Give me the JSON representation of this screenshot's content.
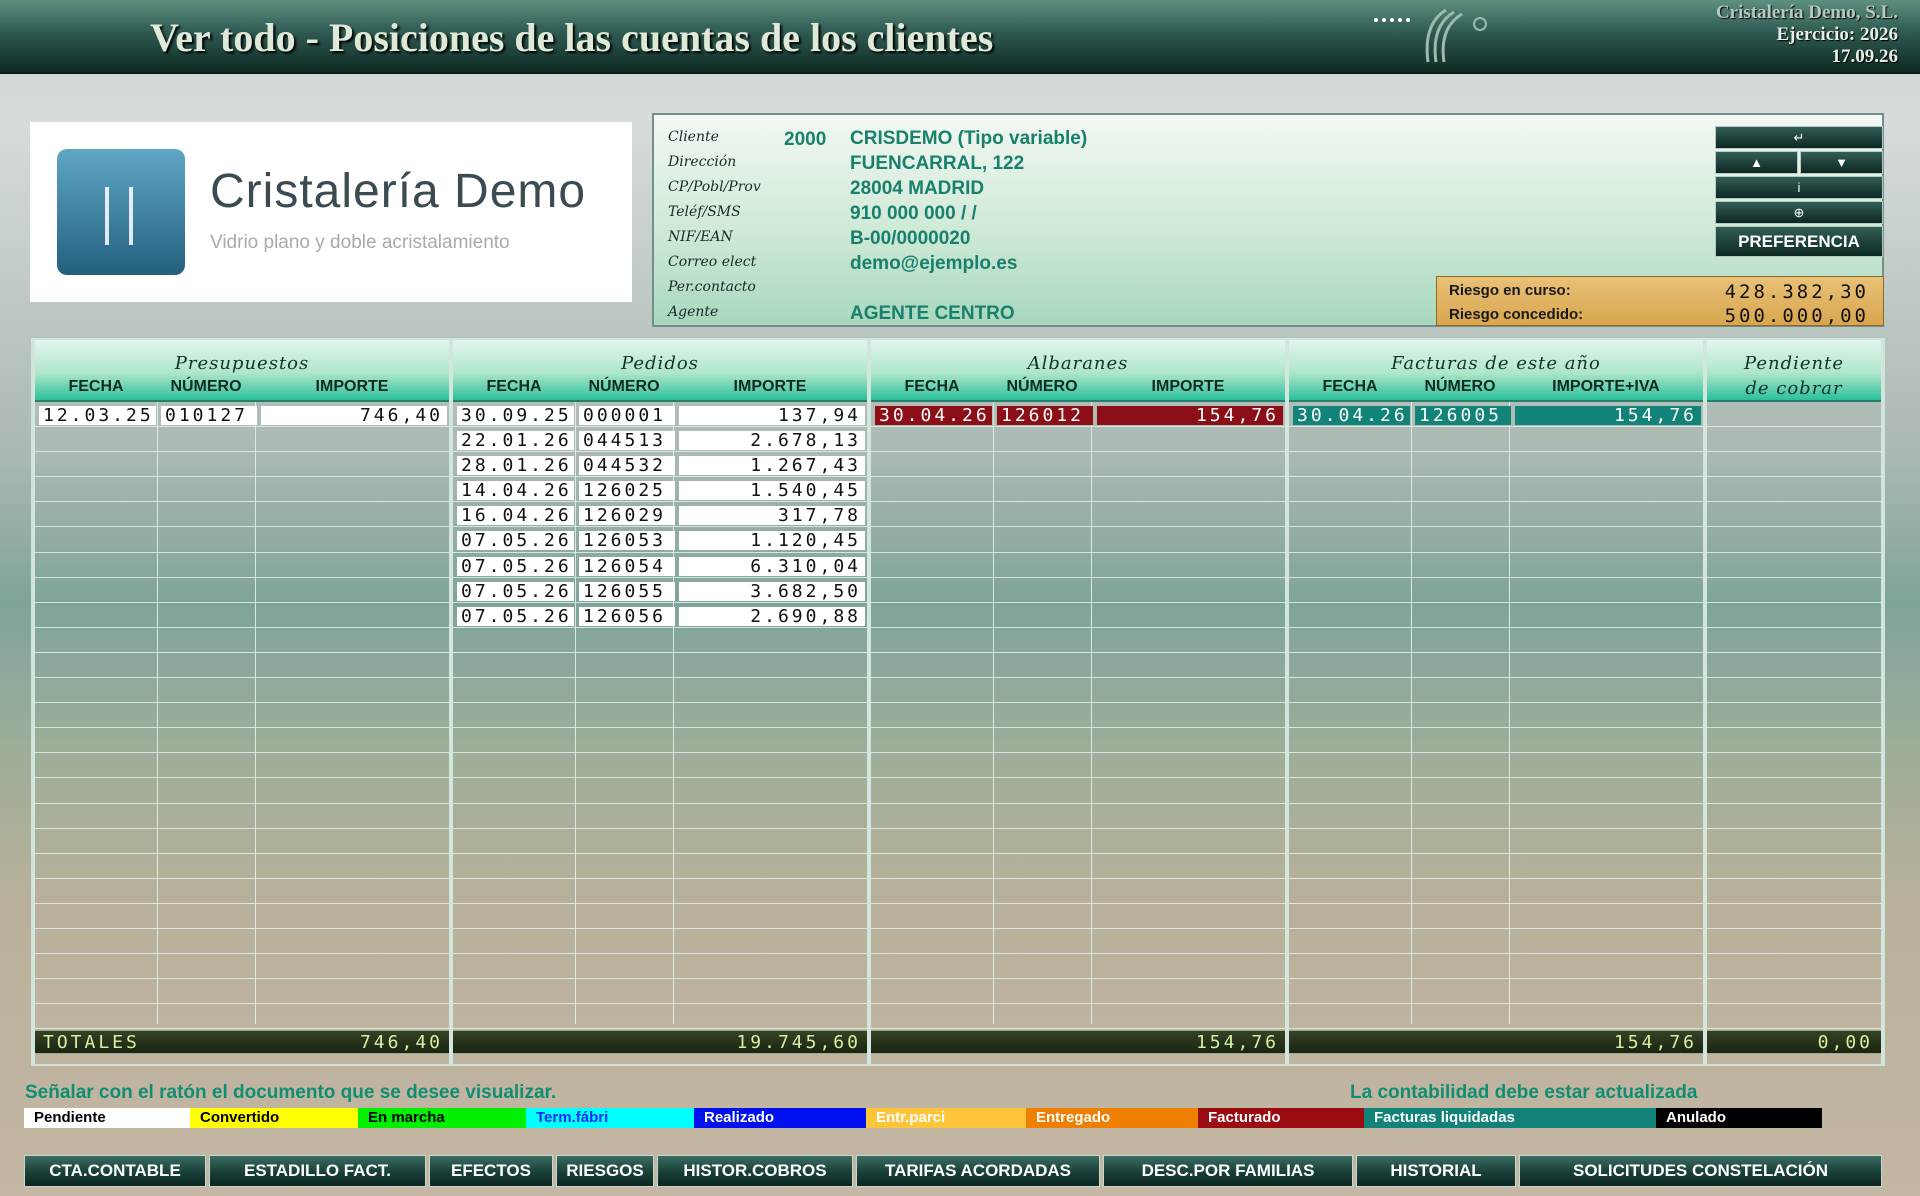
{
  "header": {
    "title": "Ver todo - Posiciones de las cuentas de los clientes",
    "company": "Cristalería Demo, S.L.",
    "ejercicio": "Ejercicio: 2026",
    "date": "17.09.26"
  },
  "logo": {
    "name": "Cristalería Demo",
    "tagline": "Vidrio plano y doble acristalamiento"
  },
  "client": {
    "labels": {
      "cliente": "Cliente",
      "direccion": "Dirección",
      "cp": "CP/Pobl/Prov",
      "telef": "Teléf/SMS",
      "nif": "NIF/EAN",
      "correo": "Correo elect",
      "percontacto": "Per.contacto",
      "agente": "Agente"
    },
    "code": "2000",
    "name": "CRISDEMO (Tipo variable)",
    "address": "FUENCARRAL, 122",
    "cp": "28004 MADRID",
    "phone": "910 000 000 /  /",
    "nif": "B-00/0000020",
    "email": "demo@ejemplo.es",
    "contact": "",
    "agent": "AGENTE CENTRO"
  },
  "nav": {
    "enter": "↵",
    "up": "▲",
    "down": "▼",
    "info": "i",
    "globe": "⊕",
    "preferencia": "PREFERENCIA"
  },
  "riesgo": {
    "curso_label": "Riesgo en curso:",
    "curso_value": "428.382,30",
    "concedido_label": "Riesgo concedido:",
    "concedido_value": "500.000,00"
  },
  "columns": {
    "fecha": "FECHA",
    "numero": "NÚMERO",
    "importe": "IMPORTE",
    "importe_iva": "IMPORTE+IVA"
  },
  "sections": {
    "presupuestos": {
      "title": "Presupuestos",
      "rows": [
        {
          "fecha": "12.03.25",
          "numero": "010127",
          "importe": "746,40",
          "status": "pendiente"
        }
      ],
      "total": "746,40",
      "total_label": "TOTALES"
    },
    "pedidos": {
      "title": "Pedidos",
      "rows": [
        {
          "fecha": "30.09.25",
          "numero": "000001",
          "importe": "137,94",
          "status": "pendiente"
        },
        {
          "fecha": "22.01.26",
          "numero": "044513",
          "importe": "2.678,13",
          "status": "pendiente"
        },
        {
          "fecha": "28.01.26",
          "numero": "044532",
          "importe": "1.267,43",
          "status": "pendiente"
        },
        {
          "fecha": "14.04.26",
          "numero": "126025",
          "importe": "1.540,45",
          "status": "pendiente"
        },
        {
          "fecha": "16.04.26",
          "numero": "126029",
          "importe": "317,78",
          "status": "pendiente"
        },
        {
          "fecha": "07.05.26",
          "numero": "126053",
          "importe": "1.120,45",
          "status": "pendiente"
        },
        {
          "fecha": "07.05.26",
          "numero": "126054",
          "importe": "6.310,04",
          "status": "pendiente"
        },
        {
          "fecha": "07.05.26",
          "numero": "126055",
          "importe": "3.682,50",
          "status": "pendiente"
        },
        {
          "fecha": "07.05.26",
          "numero": "126056",
          "importe": "2.690,88",
          "status": "pendiente"
        }
      ],
      "total": "19.745,60"
    },
    "albaranes": {
      "title": "Albaranes",
      "rows": [
        {
          "fecha": "30.04.26",
          "numero": "126012",
          "importe": "154,76",
          "status": "facturado"
        }
      ],
      "total": "154,76"
    },
    "facturas": {
      "title": "Facturas de este año",
      "rows": [
        {
          "fecha": "30.04.26",
          "numero": "126005",
          "importe": "154,76",
          "status": "liquidada"
        }
      ],
      "total": "154,76"
    },
    "pendiente": {
      "title_line1": "Pendiente",
      "title_line2": "de cobrar",
      "total": "0,00"
    }
  },
  "hint": "Señalar con el ratón el documento que se desee visualizar.",
  "hint2": "La contabilidad debe estar actualizada",
  "legend": [
    {
      "label": "Pendiente",
      "bg": "#ffffff",
      "fg": "#000000"
    },
    {
      "label": "Convertido",
      "bg": "#ffff00",
      "fg": "#000000"
    },
    {
      "label": "En marcha",
      "bg": "#00ee00",
      "fg": "#000000"
    },
    {
      "label": "Term.fábri",
      "bg": "#00ffff",
      "fg": "#1a2cff"
    },
    {
      "label": "Realizado",
      "bg": "#0010ee",
      "fg": "#ffffff"
    },
    {
      "label": "Entr.parci",
      "bg": "#ffc53a",
      "fg": "#ffffff"
    },
    {
      "label": "Entregado",
      "bg": "#ee7f00",
      "fg": "#ffffff"
    },
    {
      "label": "Facturado",
      "bg": "#9a0c12",
      "fg": "#ffffff"
    },
    {
      "label": "Facturas liquidadas",
      "bg": "#128378",
      "fg": "#ffffff"
    },
    {
      "label": "Anulado",
      "bg": "#000000",
      "fg": "#ffffff"
    }
  ],
  "bottom_buttons": [
    "CTA.CONTABLE",
    "ESTADILLO FACT.",
    "EFECTOS",
    "RIESGOS",
    "HISTOR.COBROS",
    "TARIFAS ACORDADAS",
    "DESC.POR FAMILIAS",
    "HISTORIAL",
    "SOLICITUDES CONSTELACIÓN"
  ]
}
